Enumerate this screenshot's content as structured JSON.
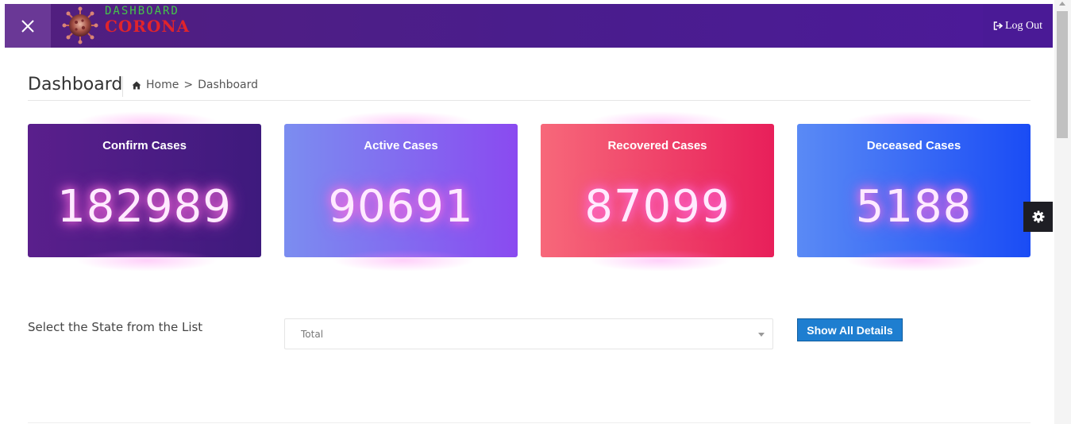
{
  "navbar": {
    "logo": {
      "line1": "DASHBOARD",
      "line2": "CORONA",
      "icon": "coronavirus-icon"
    },
    "close_icon": "close-icon",
    "logout_label": "Log Out",
    "logout_icon": "sign-out-icon",
    "colors": {
      "background": "#4a1d8c",
      "close_bg": "#6a3896",
      "logo_green": "#45c44a",
      "logo_red": "#e0242b"
    }
  },
  "header": {
    "title": "Dashboard",
    "breadcrumb": {
      "home_icon": "home-icon",
      "home": "Home",
      "separator": ">",
      "current": "Dashboard"
    }
  },
  "cards": [
    {
      "title": "Confirm Cases",
      "value": "182989",
      "colors": [
        "#5a1f8c",
        "#3e1a7d"
      ]
    },
    {
      "title": "Active Cases",
      "value": "90691",
      "colors": [
        "#7b8df0",
        "#8a4af0"
      ]
    },
    {
      "title": "Recovered Cases",
      "value": "87099",
      "colors": [
        "#f7687a",
        "#e81f5a"
      ]
    },
    {
      "title": "Deceased Cases",
      "value": "5188",
      "colors": [
        "#5a8af5",
        "#1a4cf5"
      ]
    }
  ],
  "settings_icon": "gear-icon",
  "state_select": {
    "label": "Select the State from the List",
    "selected": "Total",
    "button_label": "Show All Details",
    "button_color": "#1e7ed0"
  }
}
